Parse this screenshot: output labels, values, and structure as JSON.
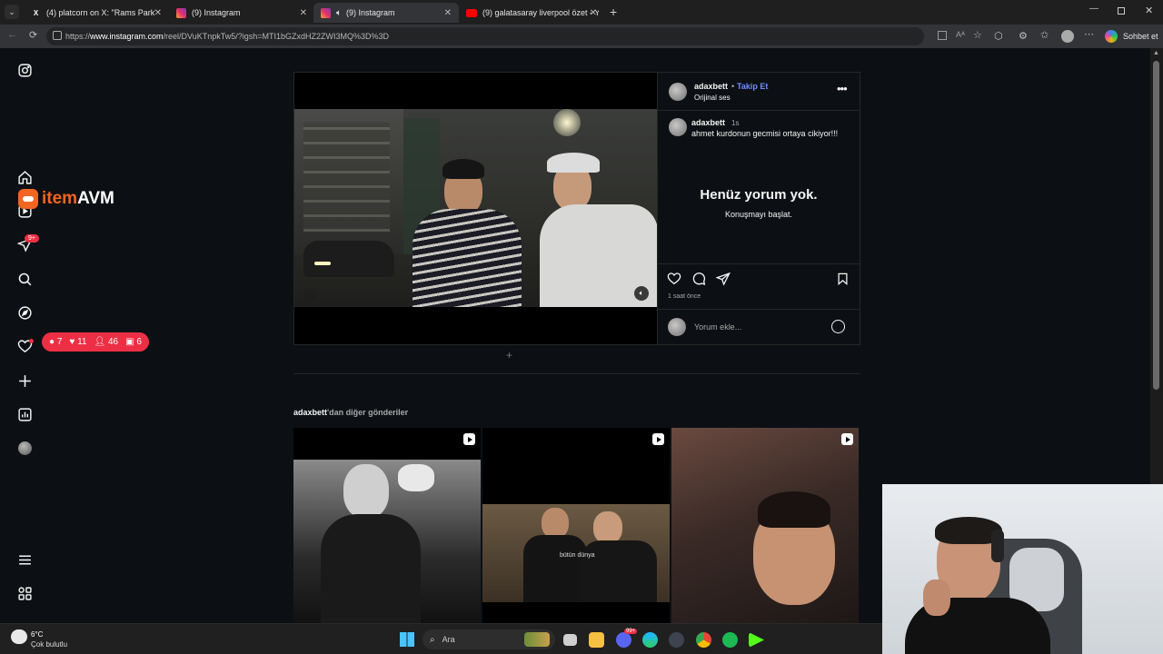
{
  "browser": {
    "tabs": [
      {
        "title": "(4) platcorn on X: \"Rams Park'ta c",
        "icon": "x-logo-icon",
        "active": false
      },
      {
        "title": "(9) Instagram",
        "icon": "instagram-icon",
        "active": false
      },
      {
        "title": "(9) Instagram",
        "icon": "instagram-icon",
        "active": true
      },
      {
        "title": "(9) galatasaray liverpool özet - You",
        "icon": "youtube-icon",
        "active": false
      }
    ],
    "url_prefix": "https://",
    "url_host": "www.instagram.com",
    "url_path": "/reel/DVuKTnpkTw5/?igsh=MTI1bGZxdHZ2ZWI3MQ%3D%3D",
    "copilot_label": "Sohbet et"
  },
  "overlay": {
    "brand_item": "item",
    "brand_avm": "AVM",
    "stats": {
      "comments": "7",
      "likes": "11",
      "followers": "46",
      "contacts": "6"
    },
    "notif_badge": "9+"
  },
  "post": {
    "username": "adaxbett",
    "separator": "•",
    "follow_label": "Takip Et",
    "audio": "Orijinal ses",
    "caption_user": "adaxbett",
    "caption_time": "1s",
    "caption_text": "ahmet kurdonun gecmisi ortaya cikiyor!!!",
    "no_comments_title": "Henüz yorum yok.",
    "no_comments_sub": "Konuşmayı başlat.",
    "time_ago": "1 saat önce",
    "comment_placeholder": "Yorum ekle..."
  },
  "more_posts": {
    "user": "adaxbett",
    "suffix": "'dan diğer gönderiler",
    "tile_text": "bütün dünya"
  },
  "taskbar": {
    "weather_temp": "6°C",
    "weather_desc": "Çok bulutlu",
    "search_placeholder": "Ara",
    "discord_badge": "99+"
  },
  "colors": {
    "accent_blue": "#708dff",
    "badge_red": "#ed2f45",
    "brand_orange": "#f26522"
  }
}
